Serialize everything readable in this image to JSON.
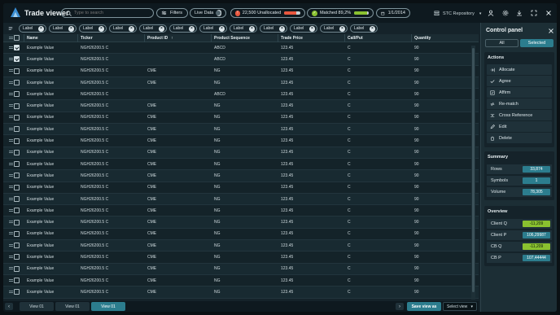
{
  "header": {
    "title": "Trade viewer",
    "search_placeholder": "Type to search",
    "filters_label": "Filters",
    "live_data_label": "Live Data",
    "unallocated_label": "22,500 Unallocated",
    "unallocated_progress": 0.75,
    "unallocated_color": "#e8573e",
    "matched_label": "Matched 89,2%",
    "matched_progress": 0.892,
    "matched_color": "#8ac12f",
    "date": "1/1/2014",
    "repository": "STC Repository"
  },
  "tags": [
    "Label",
    "Label",
    "Label",
    "Label",
    "Label",
    "Label",
    "Label",
    "Label",
    "Label",
    "Label",
    "Label",
    "Label"
  ],
  "table": {
    "columns": [
      "Name",
      "Ticker",
      "Product ID",
      "Product Sequence",
      "Trade Price",
      "Call/Put",
      "Quantity"
    ],
    "rows": [
      {
        "checked": true,
        "name": "Example Value",
        "ticker": "NGH26200.5 C",
        "pid": "",
        "seq": "ABCD",
        "price": "123.45",
        "cp": "C",
        "qty": "90"
      },
      {
        "checked": true,
        "name": "Example Value",
        "ticker": "NGH26200.5 C",
        "pid": "",
        "seq": "ABCD",
        "price": "123.45",
        "cp": "C",
        "qty": "90"
      },
      {
        "checked": false,
        "name": "Example Value",
        "ticker": "NGH26200.5 C",
        "pid": "CME",
        "seq": "NG",
        "price": "123.45",
        "cp": "C",
        "qty": "90"
      },
      {
        "checked": false,
        "name": "Example Value",
        "ticker": "NGH26200.5 C",
        "pid": "CME",
        "seq": "NG",
        "price": "123.45",
        "cp": "C",
        "qty": "90"
      },
      {
        "checked": false,
        "name": "Example Value",
        "ticker": "NGH26200.5 C",
        "pid": "",
        "seq": "ABCD",
        "price": "123.45",
        "cp": "C",
        "qty": "90"
      },
      {
        "checked": false,
        "name": "Example Value",
        "ticker": "NGH26200.5 C",
        "pid": "CME",
        "seq": "NG",
        "price": "123.45",
        "cp": "C",
        "qty": "90"
      },
      {
        "checked": false,
        "name": "Example Value",
        "ticker": "NGH26200.5 C",
        "pid": "CME",
        "seq": "NG",
        "price": "123.45",
        "cp": "C",
        "qty": "90"
      },
      {
        "checked": false,
        "name": "Example Value",
        "ticker": "NGH26200.5 C",
        "pid": "CME",
        "seq": "NG",
        "price": "123.45",
        "cp": "C",
        "qty": "90"
      },
      {
        "checked": false,
        "name": "Example Value",
        "ticker": "NGH26200.5 C",
        "pid": "CME",
        "seq": "NG",
        "price": "123.45",
        "cp": "C",
        "qty": "90"
      },
      {
        "checked": false,
        "name": "Example Value",
        "ticker": "NGH26200.5 C",
        "pid": "CME",
        "seq": "NG",
        "price": "123.45",
        "cp": "C",
        "qty": "90"
      },
      {
        "checked": false,
        "name": "Example Value",
        "ticker": "NGH26200.5 C",
        "pid": "CME",
        "seq": "NG",
        "price": "123.45",
        "cp": "C",
        "qty": "90"
      },
      {
        "checked": false,
        "name": "Example Value",
        "ticker": "NGH26200.5 C",
        "pid": "CME",
        "seq": "NG",
        "price": "123.45",
        "cp": "C",
        "qty": "90"
      },
      {
        "checked": false,
        "name": "Example Value",
        "ticker": "NGH26200.5 C",
        "pid": "CME",
        "seq": "NG",
        "price": "123.45",
        "cp": "C",
        "qty": "90"
      },
      {
        "checked": false,
        "name": "Example Value",
        "ticker": "NGH26200.5 C",
        "pid": "CME",
        "seq": "NG",
        "price": "123.45",
        "cp": "C",
        "qty": "90"
      },
      {
        "checked": false,
        "name": "Example Value",
        "ticker": "NGH26200.5 C",
        "pid": "CME",
        "seq": "NG",
        "price": "123.45",
        "cp": "C",
        "qty": "90"
      },
      {
        "checked": false,
        "name": "Example Value",
        "ticker": "NGH26200.5 C",
        "pid": "CME",
        "seq": "NG",
        "price": "123.45",
        "cp": "C",
        "qty": "90"
      },
      {
        "checked": false,
        "name": "Example Value",
        "ticker": "NGH26200.5 C",
        "pid": "CME",
        "seq": "NG",
        "price": "123.45",
        "cp": "C",
        "qty": "90"
      },
      {
        "checked": false,
        "name": "Example Value",
        "ticker": "NGH26200.5 C",
        "pid": "CME",
        "seq": "NG",
        "price": "123.45",
        "cp": "C",
        "qty": "90"
      },
      {
        "checked": false,
        "name": "Example Value",
        "ticker": "NGH26200.5 C",
        "pid": "CME",
        "seq": "NG",
        "price": "123.45",
        "cp": "C",
        "qty": "90"
      },
      {
        "checked": false,
        "name": "Example Value",
        "ticker": "NGH26200.5 C",
        "pid": "CME",
        "seq": "NG",
        "price": "123.45",
        "cp": "C",
        "qty": "90"
      },
      {
        "checked": false,
        "name": "Example Value",
        "ticker": "NGH26200.5 C",
        "pid": "CME",
        "seq": "NG",
        "price": "123.45",
        "cp": "C",
        "qty": "90"
      },
      {
        "checked": false,
        "name": "Example Value",
        "ticker": "NGH26200.5 C",
        "pid": "CME",
        "seq": "NG",
        "price": "123.45",
        "cp": "C",
        "qty": "90"
      }
    ]
  },
  "footer": {
    "view_tabs": [
      "View 01",
      "View 01",
      "View 01"
    ],
    "active_tab": 2,
    "save_label": "Save view as",
    "select_label": "Select view"
  },
  "panel": {
    "title": "Control panel",
    "seg_all": "All",
    "seg_selected": "Selected",
    "actions_title": "Actions",
    "actions": [
      {
        "label": "Allocate",
        "icon": "allocate-icon"
      },
      {
        "label": "Agree",
        "icon": "agree-icon"
      },
      {
        "label": "Affirm",
        "icon": "affirm-icon"
      },
      {
        "label": "Re-match",
        "icon": "rematch-icon"
      },
      {
        "label": "Cross Reference",
        "icon": "cross-reference-icon"
      },
      {
        "label": "Edit",
        "icon": "edit-icon"
      },
      {
        "label": "Delete",
        "icon": "delete-icon"
      }
    ],
    "summary_title": "Summary",
    "summary": [
      {
        "label": "Rows",
        "value": "33,874",
        "color": "#2c7d8e"
      },
      {
        "label": "Symbols",
        "value": "1",
        "color": "#2c7d8e"
      },
      {
        "label": "Volume",
        "value": "78,305",
        "color": "#2c7d8e"
      }
    ],
    "overview_title": "Overview",
    "overview": [
      {
        "label": "Client Q",
        "value": "-11,209",
        "color": "#8ac12f"
      },
      {
        "label": "Client P",
        "value": "106,29987",
        "color": "#2c7d8e"
      },
      {
        "label": "CB Q",
        "value": "-11,209",
        "color": "#8ac12f"
      },
      {
        "label": "CB P",
        "value": "107,44444",
        "color": "#2c7d8e"
      }
    ]
  }
}
